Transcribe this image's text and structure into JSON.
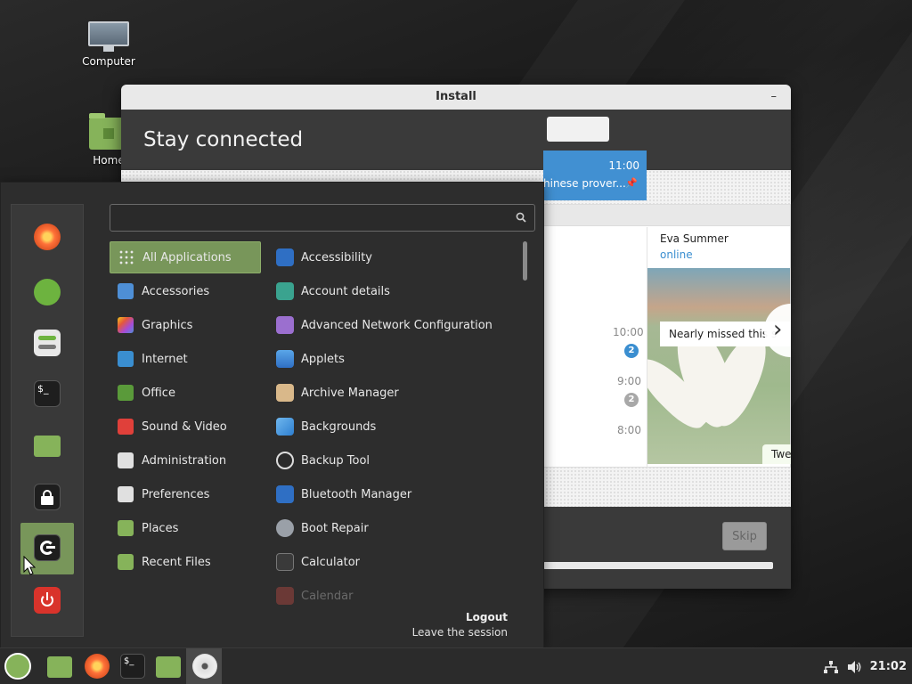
{
  "desktop": {
    "icons": [
      {
        "label": "Computer"
      },
      {
        "label": "Home"
      }
    ]
  },
  "install_window": {
    "title": "Install",
    "minimize_glyph": "–",
    "heading": "Stay connected",
    "preview": {
      "contact_name": "Eva Summer",
      "contact_status": "online",
      "selected_chat_time": "11:00",
      "selected_chat_text": "hinese prover...",
      "chat_times": [
        "10:00",
        "9:00",
        "8:00"
      ],
      "badges": [
        "2",
        "2"
      ],
      "photo_caption": "Nearly missed this s",
      "next_glyph": "›",
      "bottom_text": "Twe"
    },
    "skip_label": "Skip"
  },
  "menu": {
    "search_placeholder": "",
    "categories": [
      {
        "label": "All Applications",
        "icon": "grid-icon"
      },
      {
        "label": "Accessories",
        "icon": "scissors-icon"
      },
      {
        "label": "Graphics",
        "icon": "palette-icon"
      },
      {
        "label": "Internet",
        "icon": "cloud-icon"
      },
      {
        "label": "Office",
        "icon": "office-icon"
      },
      {
        "label": "Sound & Video",
        "icon": "play-icon"
      },
      {
        "label": "Administration",
        "icon": "toggles-icon"
      },
      {
        "label": "Preferences",
        "icon": "toggles-icon"
      },
      {
        "label": "Places",
        "icon": "folder-icon"
      },
      {
        "label": "Recent Files",
        "icon": "clock-folder-icon"
      }
    ],
    "apps": [
      {
        "label": "Accessibility",
        "icon": "accessibility-icon"
      },
      {
        "label": "Account details",
        "icon": "user-icon"
      },
      {
        "label": "Advanced Network Configuration",
        "icon": "network-icon"
      },
      {
        "label": "Applets",
        "icon": "applets-icon"
      },
      {
        "label": "Archive Manager",
        "icon": "archive-icon"
      },
      {
        "label": "Backgrounds",
        "icon": "backgrounds-icon"
      },
      {
        "label": "Backup Tool",
        "icon": "backup-icon"
      },
      {
        "label": "Bluetooth Manager",
        "icon": "bluetooth-icon"
      },
      {
        "label": "Boot Repair",
        "icon": "boot-repair-icon"
      },
      {
        "label": "Calculator",
        "icon": "calculator-icon"
      },
      {
        "label": "Calendar",
        "icon": "calendar-icon"
      }
    ],
    "logout_title": "Logout",
    "logout_subtitle": "Leave the session"
  },
  "favorites": [
    "firefox-icon",
    "software-manager-icon",
    "settings-icon",
    "terminal-icon",
    "files-icon",
    "lock-icon",
    "logout-icon",
    "power-icon"
  ],
  "taskbar": {
    "items": [
      "mint-menu-icon",
      "files-icon",
      "firefox-icon",
      "terminal-icon",
      "folder-icon",
      "disc-icon"
    ],
    "clock": "21:02"
  },
  "colors": {
    "accent": "#78965a",
    "panel": "#2b2b2b"
  }
}
